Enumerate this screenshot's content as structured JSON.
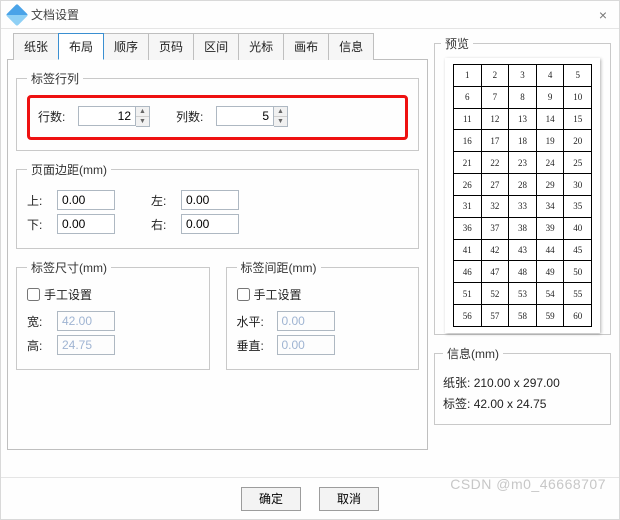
{
  "window": {
    "title": "文档设置",
    "close": "×"
  },
  "tabs": {
    "items": [
      "纸张",
      "布局",
      "顺序",
      "页码",
      "区间",
      "光标",
      "画布",
      "信息"
    ],
    "active_index": 1
  },
  "layout": {
    "grid_group": "标签行列",
    "rows_label": "行数:",
    "rows_value": "12",
    "cols_label": "列数:",
    "cols_value": "5"
  },
  "margins": {
    "group": "页面边距(mm)",
    "top_label": "上:",
    "top": "0.00",
    "left_label": "左:",
    "left": "0.00",
    "bottom_label": "下:",
    "bottom": "0.00",
    "right_label": "右:",
    "right": "0.00"
  },
  "size": {
    "group": "标签尺寸(mm)",
    "manual": "手工设置",
    "w_label": "宽:",
    "w": "42.00",
    "h_label": "高:",
    "h": "24.75"
  },
  "gap": {
    "group": "标签间距(mm)",
    "manual": "手工设置",
    "h_label": "水平:",
    "h": "0.00",
    "v_label": "垂直:",
    "v": "0.00"
  },
  "preview": {
    "group": "预览",
    "rows": 12,
    "cols": 5
  },
  "info": {
    "group": "信息(mm)",
    "paper_label": "纸张:",
    "paper": "210.00 x 297.00",
    "label_label": "标签:",
    "label": "42.00 x 24.75"
  },
  "buttons": {
    "ok": "确定",
    "cancel": "取消"
  },
  "watermark": "CSDN @m0_46668707",
  "chart_data": {
    "type": "table",
    "rows": 12,
    "cols": 5,
    "values": [
      [
        1,
        2,
        3,
        4,
        5
      ],
      [
        6,
        7,
        8,
        9,
        10
      ],
      [
        11,
        12,
        13,
        14,
        15
      ],
      [
        16,
        17,
        18,
        19,
        20
      ],
      [
        21,
        22,
        23,
        24,
        25
      ],
      [
        26,
        27,
        28,
        29,
        30
      ],
      [
        31,
        32,
        33,
        34,
        35
      ],
      [
        36,
        37,
        38,
        39,
        40
      ],
      [
        41,
        42,
        43,
        44,
        45
      ],
      [
        46,
        47,
        48,
        49,
        50
      ],
      [
        51,
        52,
        53,
        54,
        55
      ],
      [
        56,
        57,
        58,
        59,
        60
      ]
    ]
  }
}
